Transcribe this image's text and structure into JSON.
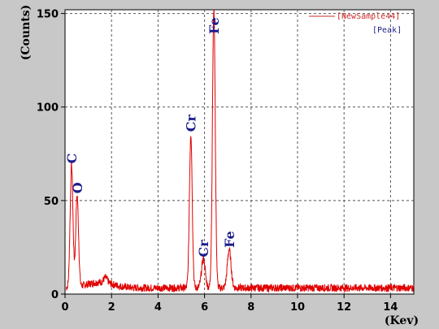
{
  "chart_data": {
    "type": "line",
    "xlabel": "(Kev)",
    "ylabel": "(Counts)",
    "xlim": [
      0,
      15
    ],
    "ylim": [
      0,
      152
    ],
    "x_ticks": [
      0,
      2,
      4,
      6,
      8,
      10,
      12,
      14
    ],
    "y_ticks": [
      0,
      50,
      100,
      150
    ],
    "grid": true,
    "legend_position": "top-right",
    "colors": {
      "series": "#e00000",
      "legend_series": "#cc2a2a",
      "legend_peak": "#1c1c8c",
      "peak_label": "#1c1c8c"
    },
    "series": [
      {
        "name": "[NewSample44]",
        "background": 2.5,
        "peaks": [
          {
            "x": 0.28,
            "y": 68
          },
          {
            "x": 0.52,
            "y": 52
          },
          {
            "x": 1.74,
            "y": 8
          },
          {
            "x": 5.41,
            "y": 85
          },
          {
            "x": 5.95,
            "y": 18
          },
          {
            "x": 6.4,
            "y": 152
          },
          {
            "x": 7.06,
            "y": 23
          }
        ]
      }
    ],
    "legend": [
      "[NewSample44]",
      "[Peak]"
    ],
    "annotations": [
      {
        "text": "C",
        "x": 0.28,
        "y": 68
      },
      {
        "text": "O",
        "x": 0.52,
        "y": 52
      },
      {
        "text": "Cr",
        "x": 5.41,
        "y": 85
      },
      {
        "text": "Cr",
        "x": 5.95,
        "y": 18
      },
      {
        "text": "Fe",
        "x": 6.4,
        "y": 152
      },
      {
        "text": "Fe",
        "x": 7.06,
        "y": 23
      }
    ]
  }
}
